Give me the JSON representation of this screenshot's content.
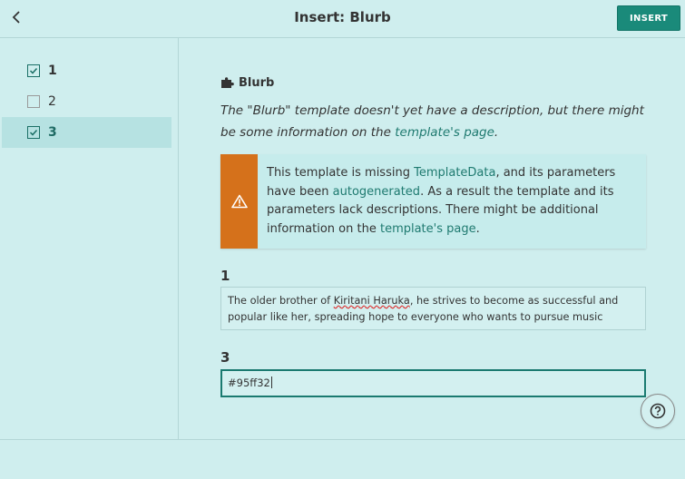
{
  "header": {
    "title": "Insert: Blurb",
    "insert_label": "INSERT"
  },
  "sidebar": {
    "items": [
      {
        "label": "1",
        "checked": true,
        "selected": false
      },
      {
        "label": "2",
        "checked": false,
        "selected": false
      },
      {
        "label": "3",
        "checked": true,
        "selected": true
      }
    ]
  },
  "template": {
    "name": "Blurb",
    "desc_before": "The \"Blurb\" template doesn't yet have a description, but there might be some information on the ",
    "desc_link": "template's page",
    "desc_after": "."
  },
  "notice": {
    "t1": "This template is missing ",
    "l1": "TemplateData",
    "t2": ", and its parameters have been ",
    "l2": "autogenerated",
    "t3": ". As a result the template and its parameters lack descriptions. There might be additional information on the ",
    "l3": "template's page",
    "t4": "."
  },
  "params": {
    "p1": {
      "label": "1",
      "before": "The older brother of ",
      "misspelled": "Kiritani Haruka",
      "after": ", he strives to become as successful and popular like her, spreading hope to everyone who wants to pursue music"
    },
    "p3": {
      "label": "3",
      "value": "#95ff32"
    }
  },
  "colors": {
    "accent": "#1a8a7a",
    "warning": "#d5711b",
    "background": "#cfeeee"
  },
  "icons": {
    "back": "back-arrow-icon",
    "puzzle": "puzzle-icon",
    "warning": "warning-icon",
    "help": "help-icon"
  }
}
